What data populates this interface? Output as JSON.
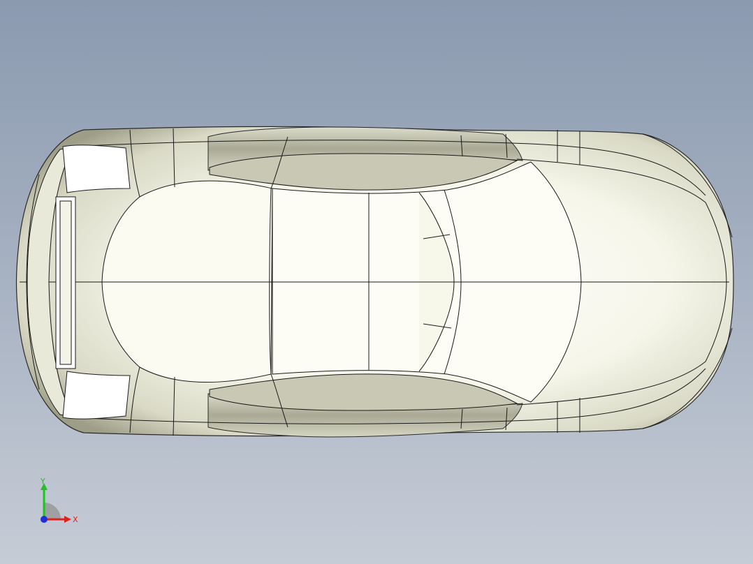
{
  "viewport": {
    "background_top": "#8b9ab0",
    "background_bottom": "#c6ccd6",
    "model": "car-body-top-view"
  },
  "triad": {
    "x_label": "X",
    "y_label": "Y",
    "x_color": "#e0201a",
    "y_color": "#1fc21f",
    "z_color": "#1f2fd8"
  }
}
